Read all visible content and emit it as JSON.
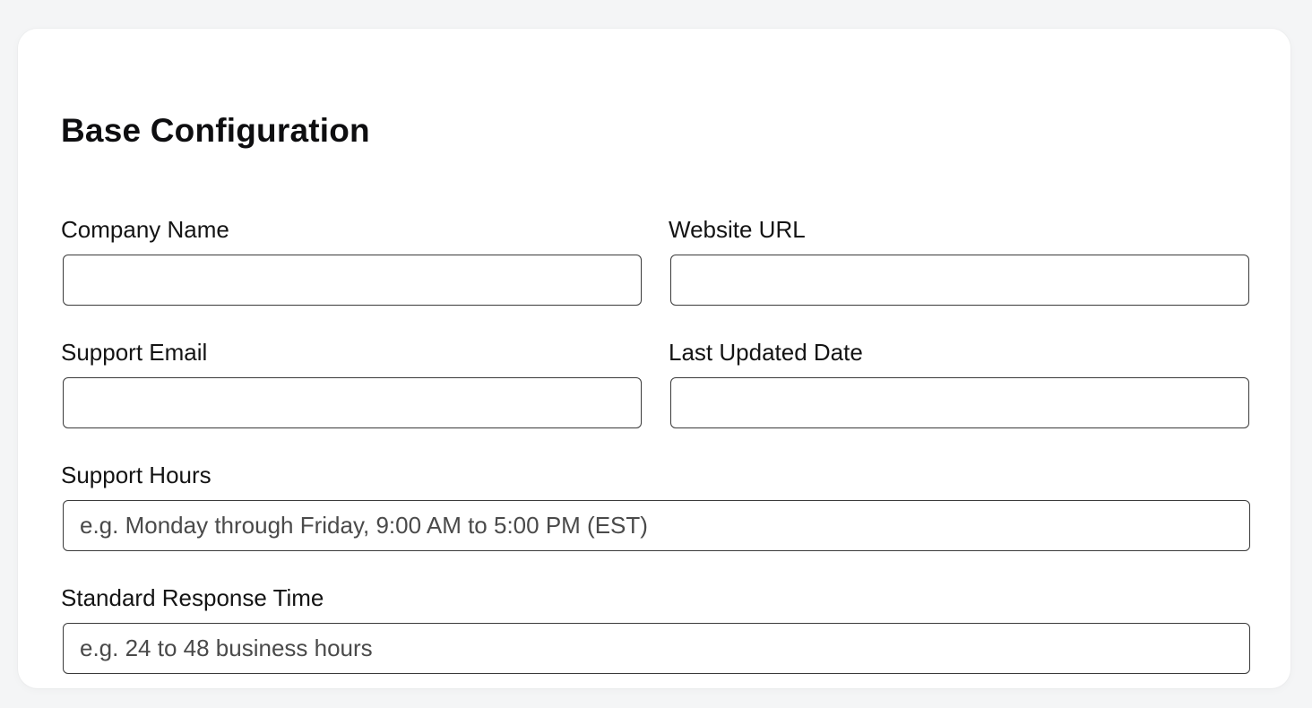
{
  "form": {
    "title": "Base Configuration",
    "fields": {
      "company_name": {
        "label": "Company Name",
        "value": "",
        "placeholder": ""
      },
      "website_url": {
        "label": "Website URL",
        "value": "",
        "placeholder": ""
      },
      "support_email": {
        "label": "Support Email",
        "value": "",
        "placeholder": ""
      },
      "last_updated_date": {
        "label": "Last Updated Date",
        "value": "",
        "placeholder": ""
      },
      "support_hours": {
        "label": "Support Hours",
        "value": "",
        "placeholder": "e.g. Monday through Friday, 9:00 AM to 5:00 PM (EST)"
      },
      "standard_response_time": {
        "label": "Standard Response Time",
        "value": "",
        "placeholder": "e.g. 24 to 48 business hours"
      }
    }
  }
}
